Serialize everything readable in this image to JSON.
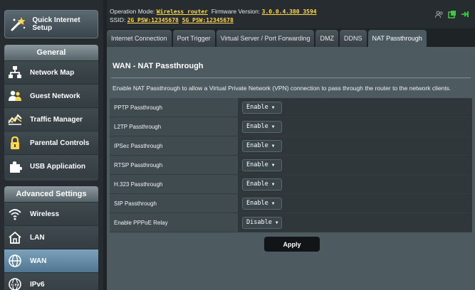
{
  "header": {
    "op_mode_label": "Operation Mode:",
    "op_mode_value": "Wireless router",
    "firmware_label": "Firmware Version:",
    "firmware_value": "3.0.0.4.380_3594",
    "ssid_label": "SSID:",
    "ssid_2g": "2G_PSW:12345678",
    "ssid_5g": "5G_PSW:12345678"
  },
  "sidebar": {
    "quick_setup": "Quick Internet Setup",
    "general_title": "General",
    "general_items": [
      {
        "label": "Network Map"
      },
      {
        "label": "Guest Network"
      },
      {
        "label": "Traffic Manager"
      },
      {
        "label": "Parental Controls"
      },
      {
        "label": "USB Application"
      }
    ],
    "advanced_title": "Advanced Settings",
    "advanced_items": [
      {
        "label": "Wireless"
      },
      {
        "label": "LAN"
      },
      {
        "label": "WAN"
      },
      {
        "label": "IPv6"
      }
    ]
  },
  "tabs": [
    {
      "label": "Internet Connection"
    },
    {
      "label": "Port Trigger"
    },
    {
      "label": "Virtual Server / Port Forwarding"
    },
    {
      "label": "DMZ"
    },
    {
      "label": "DDNS"
    },
    {
      "label": "NAT Passthrough"
    }
  ],
  "main": {
    "title": "WAN - NAT Passthrough",
    "description": "Enable NAT Passthrough to allow a Virtual Private Network (VPN) connection to pass through the router to the network clients.",
    "settings": [
      {
        "label": "PPTP Passthrough",
        "value": "Enable"
      },
      {
        "label": "L2TP Passthrough",
        "value": "Enable"
      },
      {
        "label": "IPSec Passthrough",
        "value": "Enable"
      },
      {
        "label": "RTSP Passthrough",
        "value": "Enable"
      },
      {
        "label": "H.323 Passthrough",
        "value": "Enable"
      },
      {
        "label": "SIP Passthrough",
        "value": "Enable"
      },
      {
        "label": "Enable PPPoE Relay",
        "value": "Disable"
      }
    ],
    "apply_label": "Apply"
  },
  "colors": {
    "accent_yellow": "#ffd84d",
    "active_nav": "#5e86a5",
    "status_green": "#3ec93e"
  }
}
